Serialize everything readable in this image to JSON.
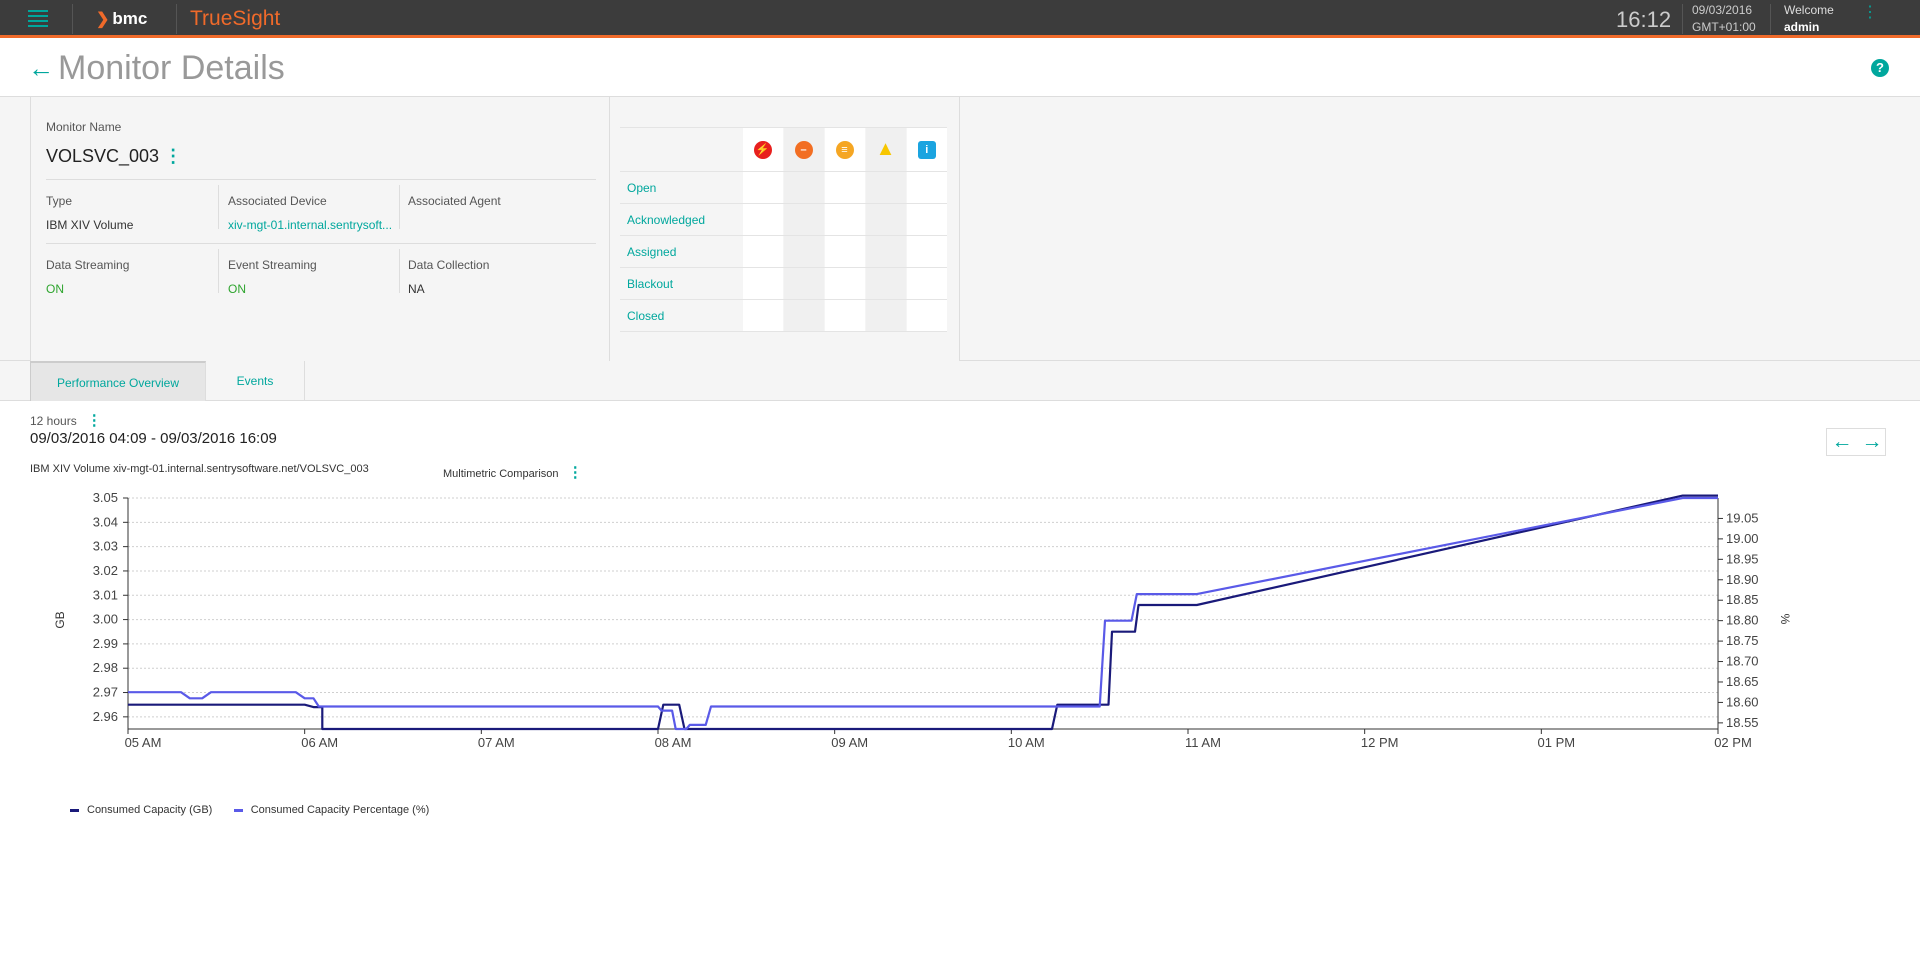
{
  "topbar": {
    "brand": "bmc",
    "product": "TrueSight",
    "time": "16:12",
    "date": "09/03/2016",
    "timezone": "GMT+01:00",
    "welcome": "Welcome",
    "user": "admin"
  },
  "page": {
    "title": "Monitor Details"
  },
  "monitor": {
    "name_label": "Monitor Name",
    "name": "VOLSVC_003",
    "type_label": "Type",
    "type": "IBM XIV Volume",
    "device_label": "Associated Device",
    "device": "xiv-mgt-01.internal.sentrysoft...",
    "agent_label": "Associated Agent",
    "agent": "",
    "data_streaming_label": "Data Streaming",
    "data_streaming": "ON",
    "event_streaming_label": "Event Streaming",
    "event_streaming": "ON",
    "data_collection_label": "Data Collection",
    "data_collection": "NA"
  },
  "events": {
    "severities": [
      {
        "icon": "critical-icon",
        "color": "#e8201e"
      },
      {
        "icon": "major-icon",
        "color": "#f26e22"
      },
      {
        "icon": "minor-icon",
        "color": "#f5a623"
      },
      {
        "icon": "warning-icon",
        "color": "#f7c600"
      },
      {
        "icon": "info-icon",
        "color": "#1ba4e0"
      }
    ],
    "rows": [
      "Open",
      "Acknowledged",
      "Assigned",
      "Blackout",
      "Closed"
    ]
  },
  "tabs": [
    {
      "label": "Performance Overview",
      "active": true
    },
    {
      "label": "Events",
      "active": false
    }
  ],
  "time_window": {
    "range": "12 hours",
    "dates": "09/03/2016 04:09 - 09/03/2016 16:09"
  },
  "chart_header": {
    "title": "IBM XIV Volume xiv-mgt-01.internal.sentrysoftware.net/VOLSVC_003",
    "comparison": "Multimetric Comparison"
  },
  "chart_data": {
    "type": "line",
    "left_axis_label": "GB",
    "right_axis_label": "%",
    "x_ticks": [
      "05 AM",
      "06 AM",
      "07 AM",
      "08 AM",
      "09 AM",
      "10 AM",
      "11 AM",
      "12 PM",
      "01 PM",
      "02 PM"
    ],
    "x_range_hours": [
      5.0,
      14.0
    ],
    "y_left_ticks": [
      "2.96",
      "2.97",
      "2.98",
      "2.99",
      "3.00",
      "3.01",
      "3.02",
      "3.03",
      "3.04",
      "3.05"
    ],
    "y_left_range": [
      2.955,
      3.05
    ],
    "y_right_ticks": [
      "18.55",
      "18.60",
      "18.65",
      "18.70",
      "18.75",
      "18.80",
      "18.85",
      "18.90",
      "18.95",
      "19.00",
      "19.05"
    ],
    "y_right_range": [
      18.535,
      19.1
    ],
    "series": [
      {
        "name": "Consumed Capacity (GB)",
        "axis": "left",
        "color": "#1a1a7a",
        "points": [
          [
            5.0,
            2.965
          ],
          [
            6.0,
            2.965
          ],
          [
            6.05,
            2.964
          ],
          [
            6.1,
            2.964
          ],
          [
            6.1,
            2.955
          ],
          [
            8.0,
            2.955
          ],
          [
            8.03,
            2.965
          ],
          [
            8.05,
            2.965
          ],
          [
            8.12,
            2.965
          ],
          [
            8.15,
            2.955
          ],
          [
            10.0,
            2.955
          ],
          [
            10.23,
            2.955
          ],
          [
            10.26,
            2.965
          ],
          [
            10.55,
            2.965
          ],
          [
            10.57,
            2.995
          ],
          [
            10.7,
            2.995
          ],
          [
            10.72,
            3.006
          ],
          [
            11.05,
            3.006
          ],
          [
            13.8,
            3.051
          ],
          [
            14.0,
            3.051
          ]
        ]
      },
      {
        "name": "Consumed Capacity Percentage (%)",
        "axis": "right",
        "color": "#5a5ae8",
        "points": [
          [
            5.0,
            18.625
          ],
          [
            5.3,
            18.625
          ],
          [
            5.35,
            18.61
          ],
          [
            5.42,
            18.61
          ],
          [
            5.47,
            18.625
          ],
          [
            5.95,
            18.625
          ],
          [
            6.0,
            18.61
          ],
          [
            6.05,
            18.61
          ],
          [
            6.08,
            18.59
          ],
          [
            8.0,
            18.59
          ],
          [
            8.02,
            18.58
          ],
          [
            8.08,
            18.58
          ],
          [
            8.1,
            18.535
          ],
          [
            8.16,
            18.535
          ],
          [
            8.18,
            18.545
          ],
          [
            8.27,
            18.545
          ],
          [
            8.3,
            18.59
          ],
          [
            10.5,
            18.59
          ],
          [
            10.53,
            18.8
          ],
          [
            10.68,
            18.8
          ],
          [
            10.71,
            18.865
          ],
          [
            11.05,
            18.865
          ],
          [
            13.8,
            19.1
          ],
          [
            14.0,
            19.1
          ]
        ]
      }
    ],
    "grid": true,
    "legend_position": "bottom-left"
  },
  "legend": [
    {
      "label": "Consumed Capacity (GB)",
      "color": "#1a1a7a"
    },
    {
      "label": "Consumed Capacity Percentage (%)",
      "color": "#5a5ae8"
    }
  ]
}
